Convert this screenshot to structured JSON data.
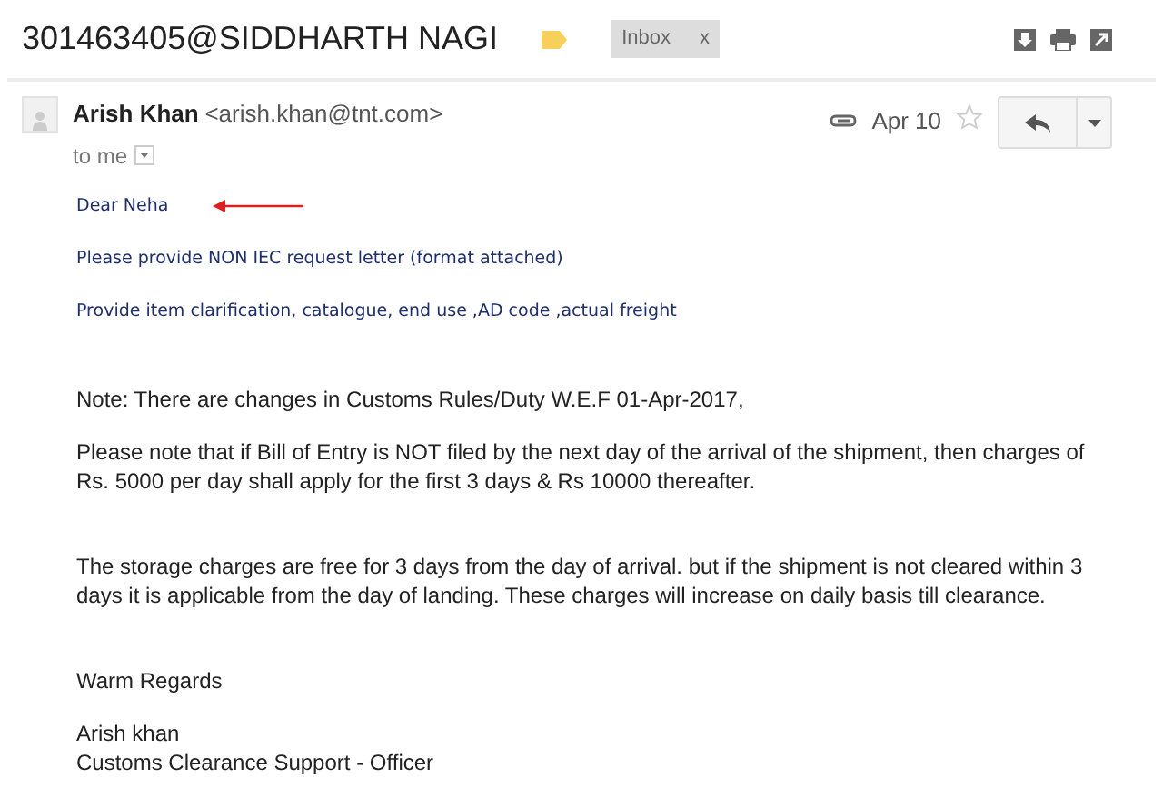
{
  "subject": "301463405@SIDDHARTH NAGI",
  "labels": [
    {
      "text": "Inbox",
      "remove": "x"
    }
  ],
  "sender": {
    "name": "Arish Khan",
    "email": "<arish.khan@tnt.com>",
    "recipient": "to me",
    "date": "Apr 10",
    "starred": false,
    "has_attachment": true
  },
  "body": [
    {
      "kind": "quote",
      "text": "Dear Neha",
      "arrow": true
    },
    {
      "kind": "quote",
      "text": "Please provide NON IEC request letter (format attached)"
    },
    {
      "kind": "quote",
      "text": "Provide item clarification, catalogue, end use ,AD code ,actual freight"
    },
    {
      "kind": "gap"
    },
    {
      "kind": "para",
      "text": "Note: There are changes in Customs Rules/Duty W.E.F 01-Apr-2017,"
    },
    {
      "kind": "para",
      "text": "Please note that if Bill of Entry is NOT filed by the next day of the arrival of the shipment, then charges of Rs. 5000 per day shall apply for the first 3 days & Rs 10000 thereafter."
    },
    {
      "kind": "gap"
    },
    {
      "kind": "para",
      "text": "The storage charges are free for 3 days from the day of arrival. but if the shipment is not cleared within 3 days it is applicable from the day of landing. These charges will increase on daily basis till clearance."
    },
    {
      "kind": "gap"
    },
    {
      "kind": "para",
      "text": "Warm Regards"
    },
    {
      "kind": "sig",
      "lines": [
        "Arish khan",
        "Customs Clearance Support - Officer"
      ]
    }
  ]
}
